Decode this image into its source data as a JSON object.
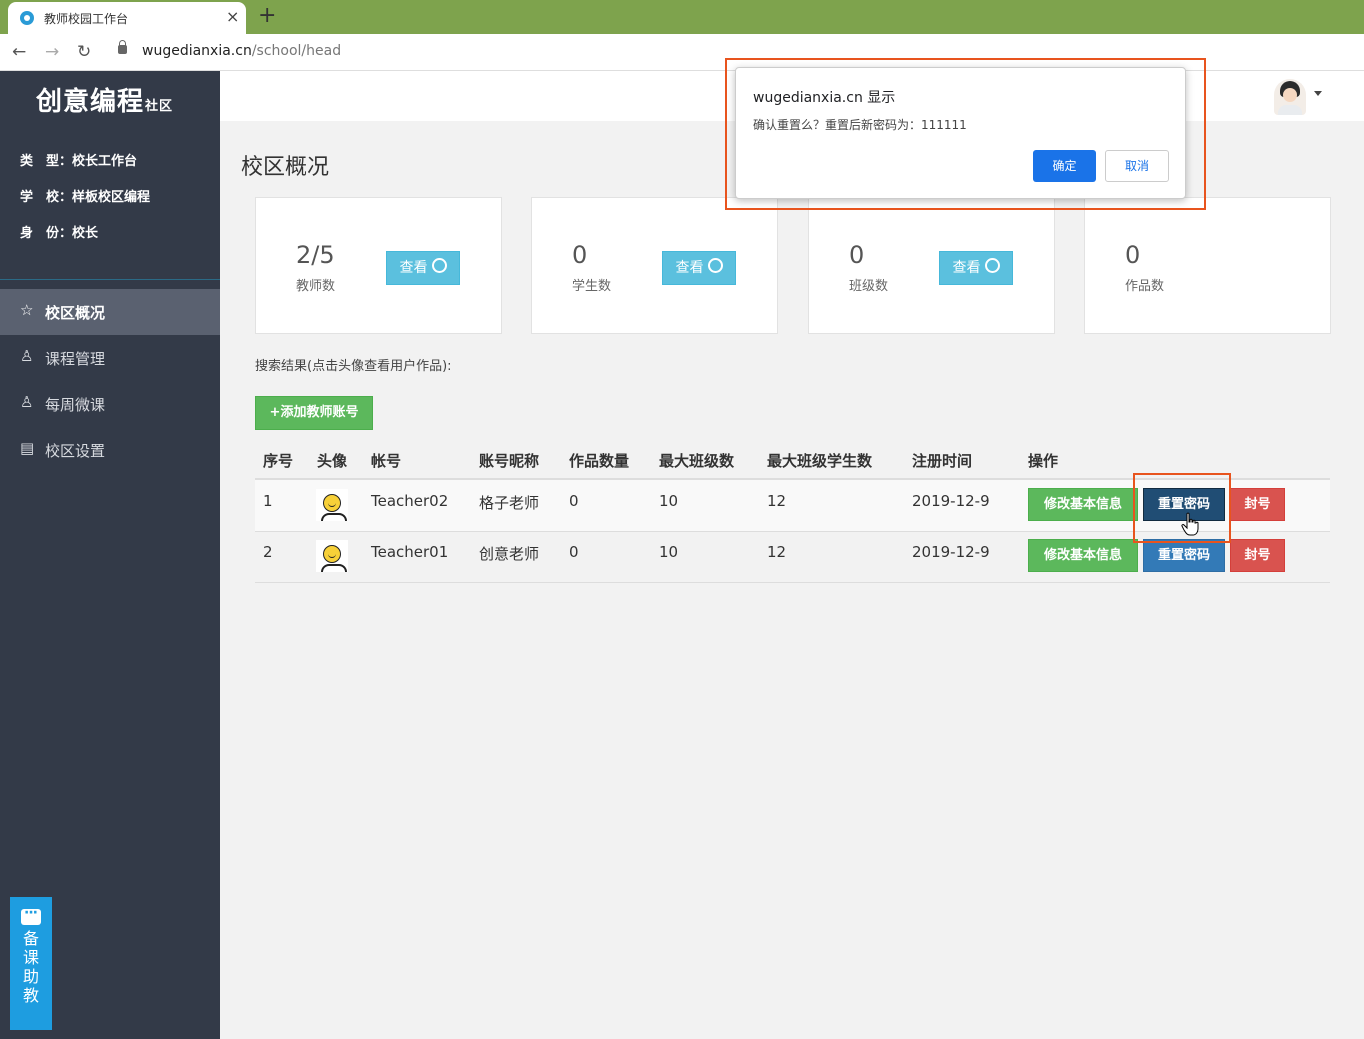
{
  "browser": {
    "tab_title": "教师校园工作台",
    "tab_close": "×",
    "new_tab": "+",
    "url_host": "wugedianxia.cn",
    "url_path": "/school/head"
  },
  "sidebar": {
    "logo_main": "创意编程",
    "logo_sub": "社区",
    "info": {
      "type": "类　型：校长工作台",
      "school": "学　校：样板校区编程",
      "identity": "身　份：校长"
    },
    "menu": [
      {
        "label": "校区概况",
        "icon": "star-icon",
        "glyph": "☆"
      },
      {
        "label": "课程管理",
        "icon": "user-icon",
        "glyph": "♙"
      },
      {
        "label": "每周微课",
        "icon": "user-icon",
        "glyph": "♙"
      },
      {
        "label": "校区设置",
        "icon": "document-icon",
        "glyph": "▤"
      }
    ],
    "helper_text": "备课助教"
  },
  "main": {
    "title": "校区概况",
    "stats": [
      {
        "value": "2/5",
        "label": "教师数",
        "button": "查看"
      },
      {
        "value": "0",
        "label": "学生数",
        "button": "查看"
      },
      {
        "value": "0",
        "label": "班级数",
        "button": "查看"
      },
      {
        "value": "0",
        "label": "作品数"
      }
    ],
    "result_note": "搜索结果(点击头像查看用户作品):",
    "add_button": "+添加教师账号"
  },
  "table": {
    "headers": [
      "序号",
      "头像",
      "帐号",
      "账号昵称",
      "作品数量",
      "最大班级数",
      "最大班级学生数",
      "注册时间",
      "操作"
    ],
    "rows": [
      {
        "index": "1",
        "account": "Teacher02",
        "nickname": "格子老师",
        "works": "0",
        "max_classes": "10",
        "max_students": "12",
        "registered": "2019-12-9"
      },
      {
        "index": "2",
        "account": "Teacher01",
        "nickname": "创意老师",
        "works": "0",
        "max_classes": "10",
        "max_students": "12",
        "registered": "2019-12-9"
      }
    ],
    "actions": {
      "edit": "修改基本信息",
      "reset": "重置密码",
      "ban": "封号"
    }
  },
  "dialog": {
    "title": "wugedianxia.cn 显示",
    "message": "确认重置么？重置后新密码为：111111",
    "ok": "确定",
    "cancel": "取消"
  },
  "colors": {
    "tabbar": "#7ea34d",
    "sidebar": "#333a48",
    "highlight": "#e8541e",
    "info_btn": "#5bc0de",
    "success_btn": "#5cb85c",
    "primary_btn": "#337ab7",
    "danger_btn": "#d9534f",
    "dialog_ok": "#1a73e8"
  }
}
